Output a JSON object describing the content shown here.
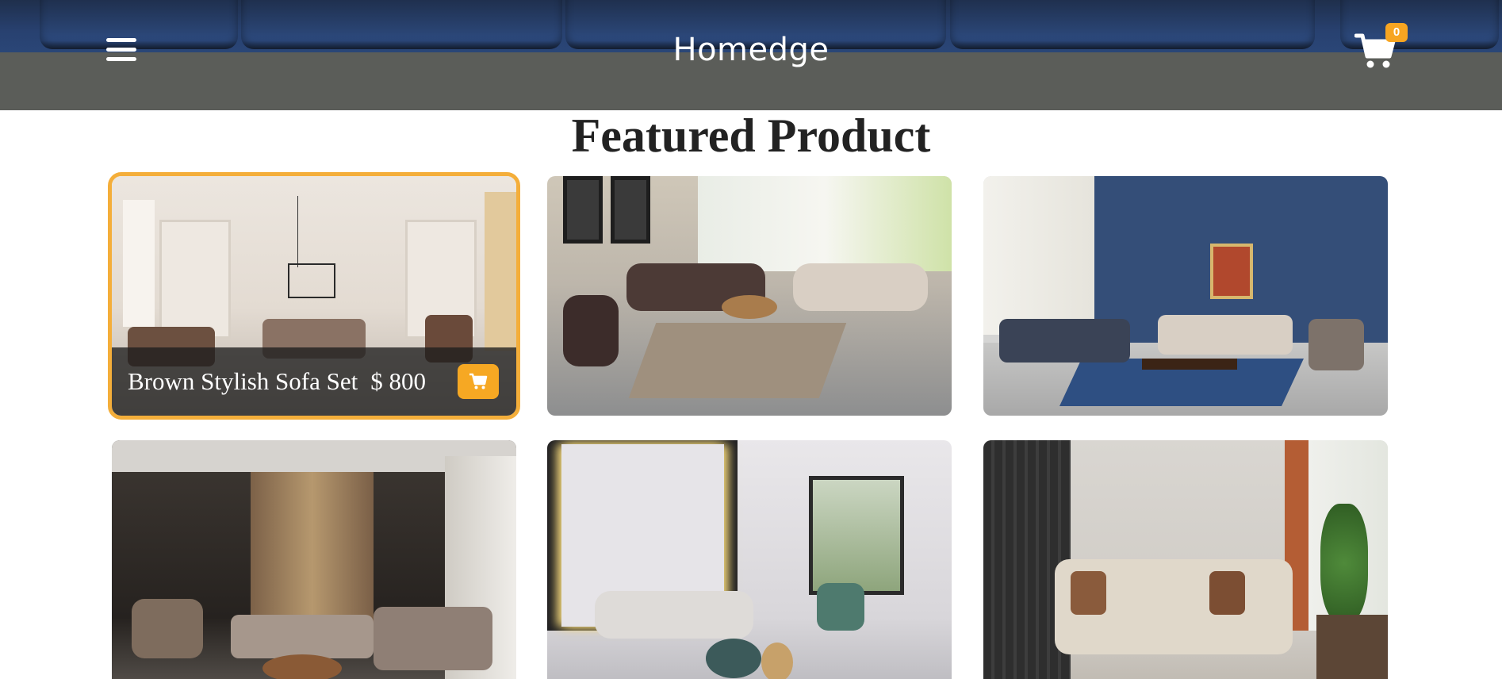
{
  "header": {
    "brand": "Homedge",
    "cart_count": "0",
    "menu_icon": "hamburger-icon",
    "cart_icon": "shopping-cart-icon"
  },
  "section": {
    "title": "Featured Product"
  },
  "products": [
    {
      "name": "Brown Stylish Sofa Set",
      "price": "$ 800",
      "button_icon": "shopping-cart-icon"
    }
  ],
  "colors": {
    "accent": "#f6a823",
    "header_bar": "#5b5d59",
    "title": "#222222"
  }
}
